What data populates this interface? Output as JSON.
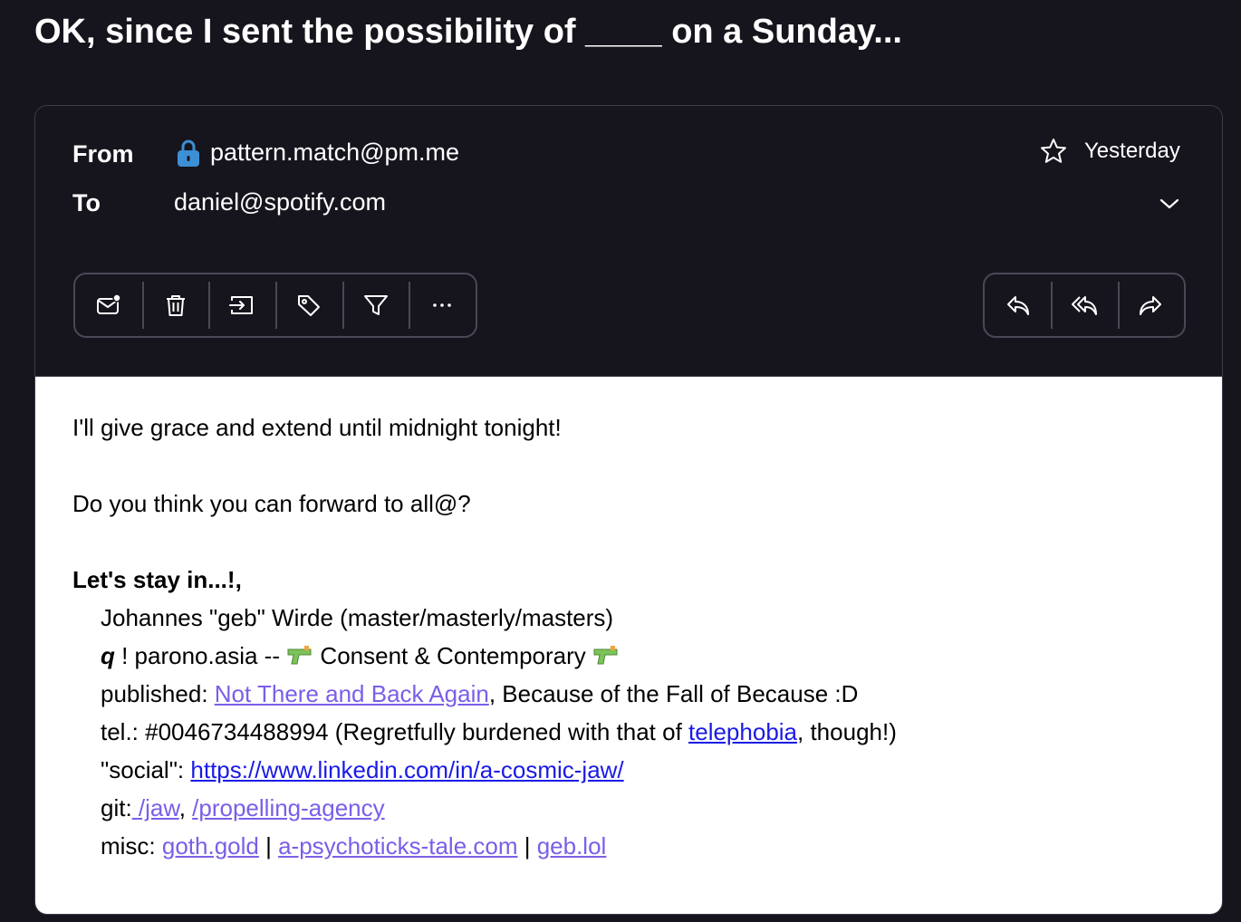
{
  "subject": "OK, since I sent the possibility of ____ on a Sunday...",
  "header": {
    "from_label": "From",
    "from_address": "pattern.match@pm.me",
    "to_label": "To",
    "to_address": "daniel@spotify.com",
    "date": "Yesterday"
  },
  "toolbar": {
    "left": [
      {
        "name": "mark-unread",
        "icon": "envelope-dot-icon"
      },
      {
        "name": "trash",
        "icon": "trash-icon"
      },
      {
        "name": "move",
        "icon": "move-to-folder-icon"
      },
      {
        "name": "label",
        "icon": "tag-icon"
      },
      {
        "name": "filter",
        "icon": "filter-icon"
      },
      {
        "name": "more",
        "icon": "more-dots-icon"
      }
    ],
    "right": [
      {
        "name": "reply",
        "icon": "reply-icon"
      },
      {
        "name": "reply-all",
        "icon": "reply-all-icon"
      },
      {
        "name": "forward",
        "icon": "forward-icon"
      }
    ]
  },
  "body": {
    "line1": "I'll give grace and extend until midnight tonight!",
    "line2": "Do you think you can forward to all@?",
    "signoff": "Let's stay in...!,",
    "sig_name": "Johannes \"geb\" Wirde (master/masterly/masters)",
    "sig_q": "q",
    "sig_q_rest": " ! parono.asia -- ",
    "sig_consent": " Consent & Contemporary ",
    "published_prefix": "published: ",
    "published_link": "Not There and Back Again",
    "published_suffix": ", Because of the Fall of Because :D",
    "tel_prefix": "tel.: #0046734488994 (Regretfully burdened with that of ",
    "tel_link": "telephobia",
    "tel_suffix": ", though!)",
    "social_prefix": "\"social\": ",
    "social_link": "https://www.linkedin.com/in/a-cosmic-jaw/",
    "git_prefix": "git:",
    "git_link1": " /jaw",
    "git_sep": ", ",
    "git_link2": "/propelling-agency",
    "misc_prefix": "misc: ",
    "misc_link1": "goth.gold",
    "misc_sep1": " | ",
    "misc_link2": "a-psychoticks-tale.com",
    "misc_sep2": " | ",
    "misc_link3": "geb.lol"
  },
  "colors": {
    "background": "#16151d",
    "border": "#3d3b48",
    "link_purple": "#7b5ee8",
    "link_blue": "#1a1ae6",
    "lock_blue": "#3d8fd6"
  }
}
